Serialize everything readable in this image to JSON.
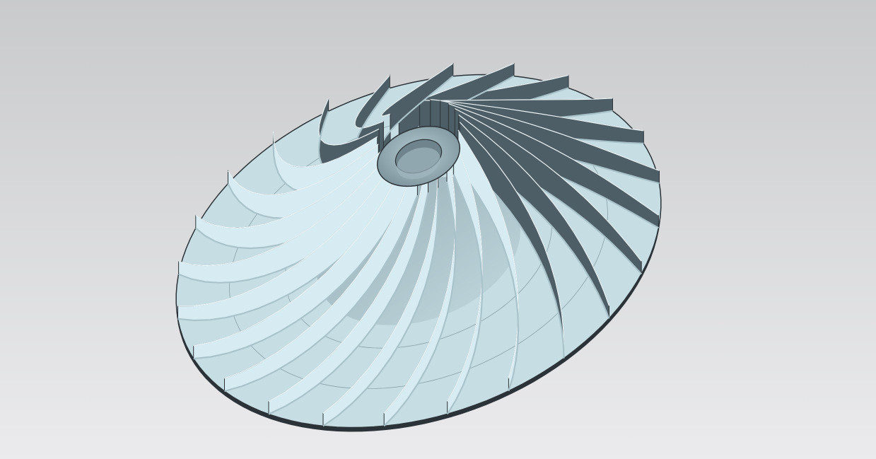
{
  "viewport": {
    "background_top": "#c9cacc",
    "background_bottom": "#ebebed"
  },
  "model": {
    "name": "impeller",
    "blade_count": 24,
    "colors": {
      "face_light": "#c6dde3",
      "face_mid": "#aac3cb",
      "face_dark": "#5c6d75",
      "edge": "#2b3338",
      "blade_light": "#d7ecf2",
      "blade_dark": "#4e5e66"
    }
  }
}
